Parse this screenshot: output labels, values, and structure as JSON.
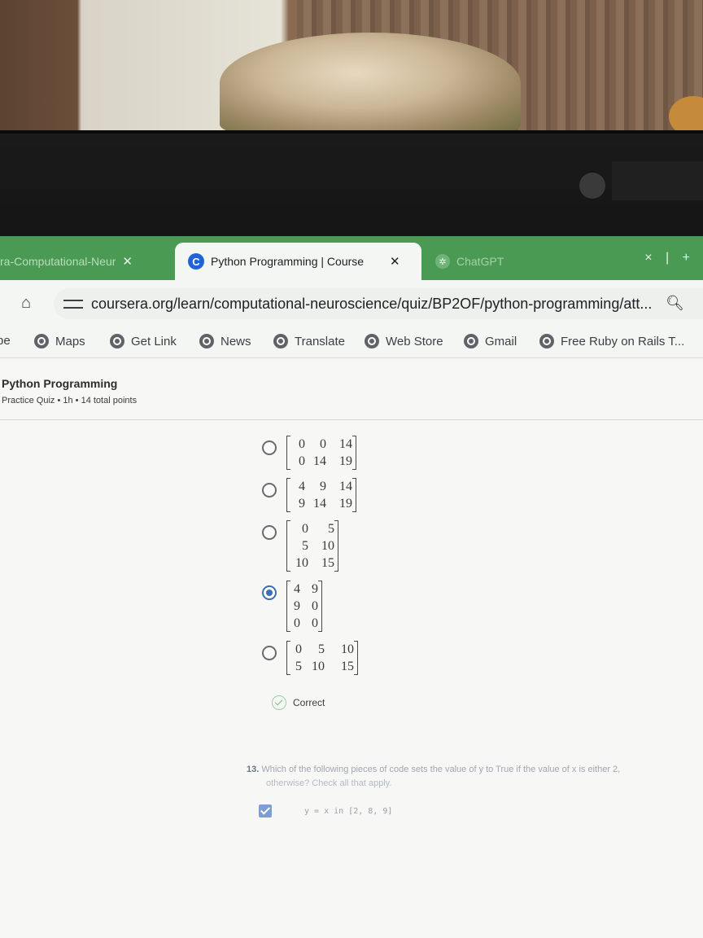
{
  "tabs": [
    {
      "title": "ra-Computational-Neur",
      "close": "✕",
      "active": false
    },
    {
      "title": "Python Programming | Course",
      "close": "✕",
      "active": true,
      "favicon": "C"
    },
    {
      "title": "ChatGPT",
      "active": false
    }
  ],
  "window_controls": {
    "label": "× | +"
  },
  "address": {
    "url": "coursera.org/learn/computational-neuroscience/quiz/BP2OF/python-programming/att..."
  },
  "bookmarks": [
    "be",
    "Maps",
    "Get Link",
    "News",
    "Translate",
    "Web Store",
    "Gmail",
    "Free Ruby on Rails T..."
  ],
  "quiz": {
    "title": "Python Programming",
    "meta": "Practice Quiz • 1h • 14 total points"
  },
  "options": [
    {
      "rows": [
        [
          "0",
          "0",
          "14"
        ],
        [
          "0",
          "14",
          "19"
        ]
      ],
      "selected": false
    },
    {
      "rows": [
        [
          "4",
          "9",
          "14"
        ],
        [
          "9",
          "14",
          "19"
        ]
      ],
      "selected": false
    },
    {
      "rows": [
        [
          "0",
          "5"
        ],
        [
          "5",
          "10"
        ],
        [
          "10",
          "15"
        ]
      ],
      "selected": false
    },
    {
      "rows": [
        [
          "4",
          "9"
        ],
        [
          "9",
          "0"
        ],
        [
          "0",
          "0"
        ]
      ],
      "selected": true
    },
    {
      "rows": [
        [
          "0",
          "5",
          "10"
        ],
        [
          "5",
          "10",
          "15"
        ]
      ],
      "selected": false
    }
  ],
  "feedback": {
    "text": "Correct"
  },
  "question13": {
    "number": "13.",
    "text": "Which of the following pieces of code sets the value of y to True if the value of x is either 2,",
    "text2": "otherwise? Check all that apply.",
    "answer_code": "y = x in [2, 8, 9]",
    "answer_checked": true
  },
  "colors": {
    "tabstrip": "#4a9a54",
    "accent": "#1f63d8",
    "selected_radio": "#3d6fb1"
  },
  "icons": {
    "home": "home-icon",
    "tune": "tune-icon",
    "search": "search-icon",
    "bookmark": "globe-icon"
  }
}
